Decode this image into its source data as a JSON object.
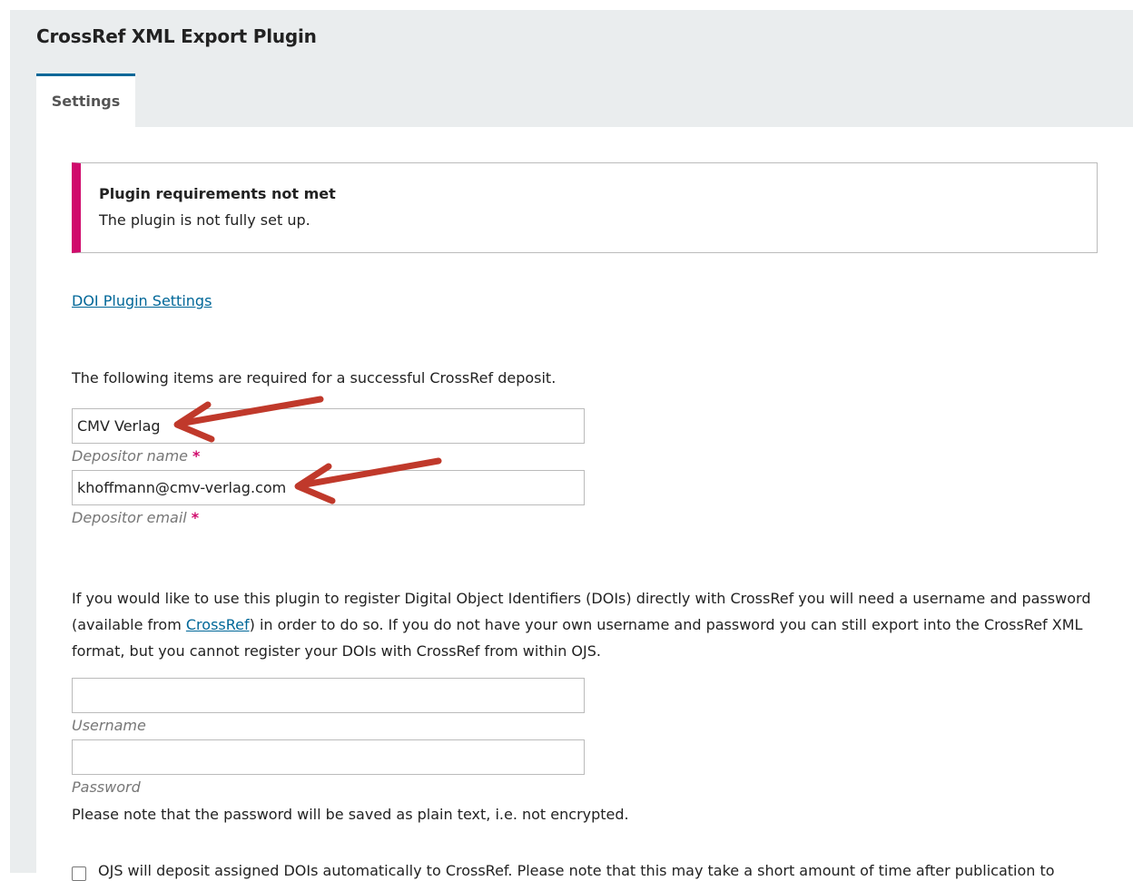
{
  "header": {
    "title": "CrossRef XML Export Plugin"
  },
  "tabs": [
    {
      "label": "Settings"
    }
  ],
  "notice": {
    "title": "Plugin requirements not met",
    "text": "The plugin is not fully set up.",
    "accent_color": "#d00a6c"
  },
  "links": {
    "doi_plugin_settings": "DOI Plugin Settings"
  },
  "form": {
    "required_intro": "The following items are required for a successful CrossRef deposit.",
    "depositor_name": {
      "value": "CMV Verlag",
      "label": "Depositor name",
      "required_mark": "*"
    },
    "depositor_email": {
      "value": "khoffmann@cmv-verlag.com",
      "label": "Depositor email",
      "required_mark": "*"
    },
    "register_info": {
      "before_link": "If you would like to use this plugin to register Digital Object Identifiers (DOIs) directly with CrossRef you will need a username and password (available from ",
      "link_text": "CrossRef",
      "after_link": ") in order to do so. If you do not have your own username and password you can still export into the CrossRef XML format, but you cannot register your DOIs with CrossRef from within OJS."
    },
    "username": {
      "value": "",
      "label": "Username"
    },
    "password": {
      "value": "",
      "label": "Password",
      "note": "Please note that the password will be saved as plain text, i.e. not encrypted."
    },
    "auto_deposit": {
      "checked": false,
      "label": "OJS will deposit assigned DOIs automatically to CrossRef. Please note that this may take a short amount of time after publication to"
    }
  },
  "colors": {
    "link": "#006798",
    "tab_accent": "#006798",
    "required": "#d00a6c",
    "annotation_arrow": "#c0392b",
    "page_bg": "#eaedee"
  }
}
